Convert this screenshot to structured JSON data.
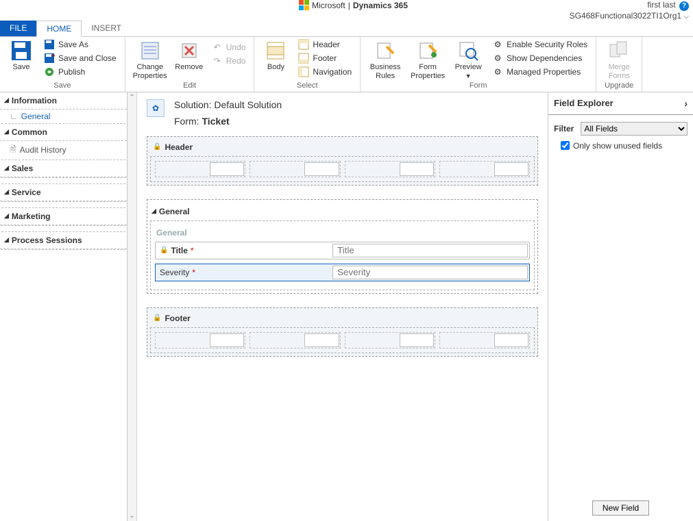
{
  "brand": {
    "company": "Microsoft",
    "divider": "|",
    "product": "Dynamics 365"
  },
  "user": {
    "name": "first last",
    "org": "SG468Functional3022TI1Org1"
  },
  "tabs": {
    "file": "FILE",
    "home": "HOME",
    "insert": "INSERT"
  },
  "ribbon": {
    "save_group": "Save",
    "save": "Save",
    "save_as": "Save As",
    "save_close": "Save and Close",
    "publish": "Publish",
    "edit_group": "Edit",
    "change_props": "Change\nProperties",
    "remove": "Remove",
    "undo": "Undo",
    "redo": "Redo",
    "select_group": "Select",
    "body": "Body",
    "header": "Header",
    "footer": "Footer",
    "navigation": "Navigation",
    "form_group": "Form",
    "business_rules": "Business\nRules",
    "form_props": "Form\nProperties",
    "preview": "Preview",
    "enable_security": "Enable Security Roles",
    "show_deps": "Show Dependencies",
    "managed_props": "Managed Properties",
    "upgrade_group": "Upgrade",
    "merge_forms": "Merge\nForms"
  },
  "nav": {
    "information": "Information",
    "general": "General",
    "common": "Common",
    "audit": "Audit History",
    "sales": "Sales",
    "service": "Service",
    "marketing": "Marketing",
    "process": "Process Sessions"
  },
  "form": {
    "solution_prefix": "Solution: ",
    "solution": "Default Solution",
    "form_prefix": "Form: ",
    "form_name": "Ticket",
    "header_section": "Header",
    "footer_section": "Footer",
    "general_tab": "General",
    "general_subsection": "General",
    "title_label": "Title",
    "title_placeholder": "Title",
    "severity_label": "Severity",
    "severity_placeholder": "Severity"
  },
  "explorer": {
    "title": "Field Explorer",
    "filter_label": "Filter",
    "filter_value": "All Fields",
    "unused_label": "Only show unused fields",
    "new_field": "New Field"
  }
}
